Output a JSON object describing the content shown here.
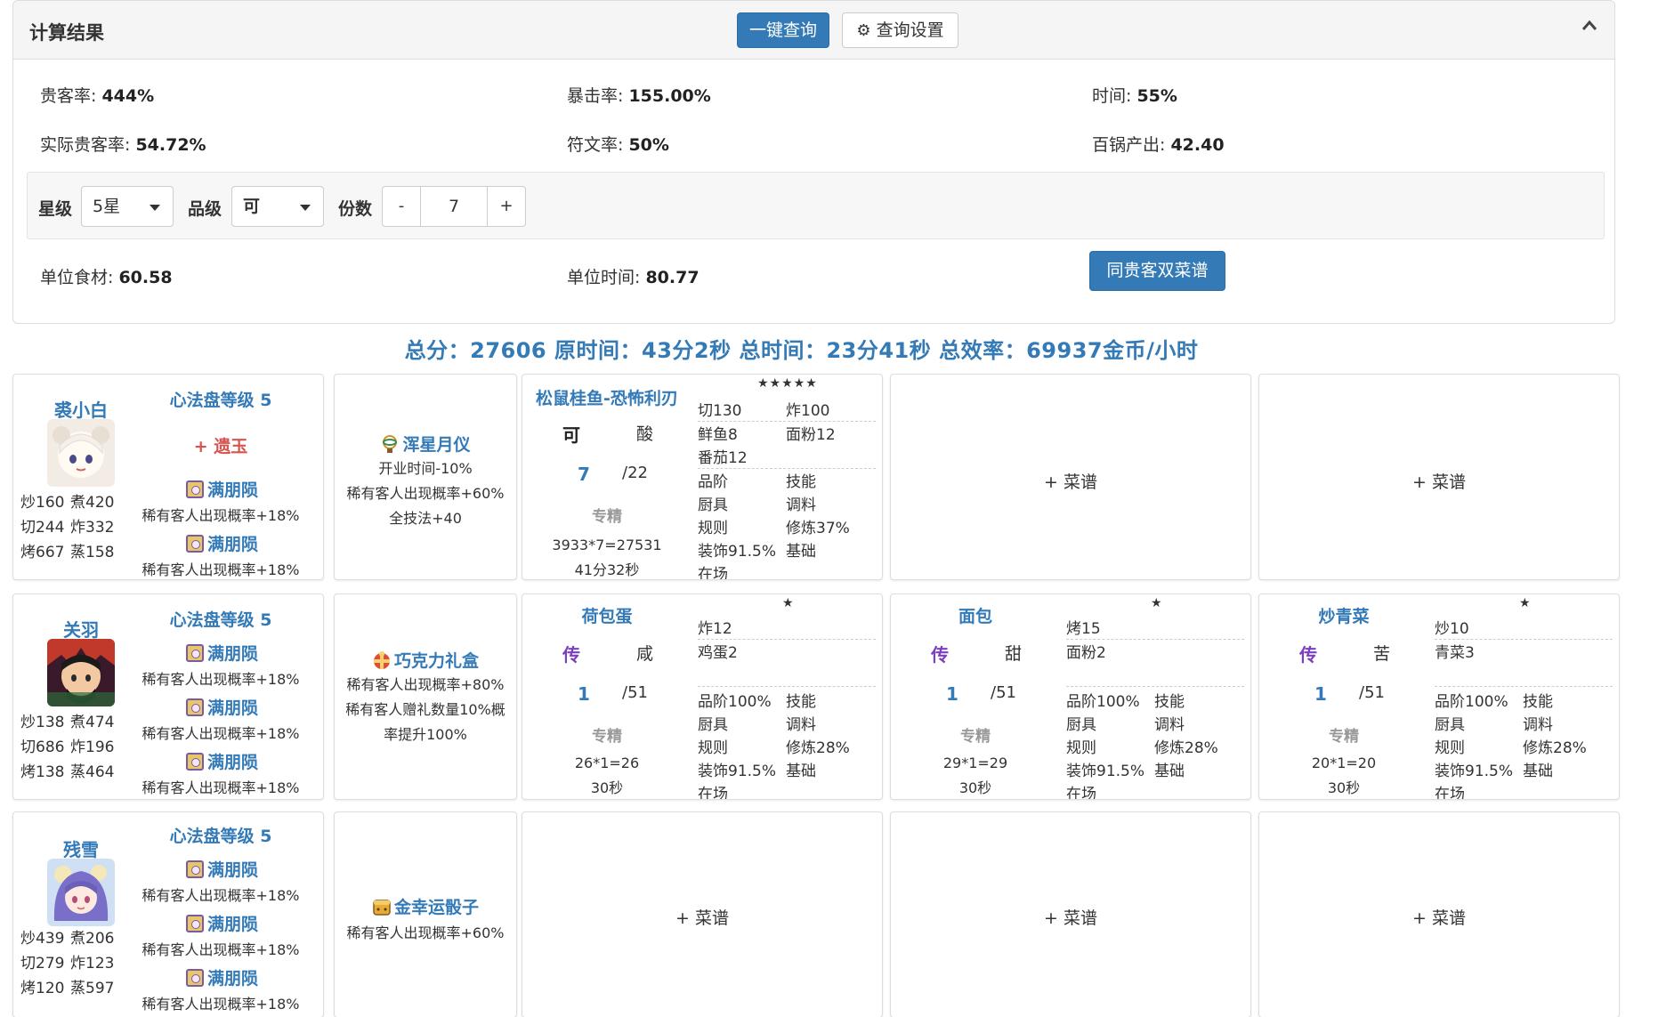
{
  "panel": {
    "title": "计算结果",
    "query_button": "一键查询",
    "settings_button": "查询设置",
    "stats": {
      "guest_rate_label": "贵客率:",
      "guest_rate": "444%",
      "crit_rate_label": "暴击率:",
      "crit_rate": "155.00%",
      "time_label": "时间:",
      "time": "55%",
      "actual_guest_rate_label": "实际贵客率:",
      "actual_guest_rate": "54.72%",
      "rune_rate_label": "符文率:",
      "rune_rate": "50%",
      "pot_output_label": "百锅产出:",
      "pot_output": "42.40",
      "unit_food_label": "单位食材:",
      "unit_food": "60.58",
      "unit_time_label": "单位时间:",
      "unit_time": "80.77"
    },
    "filters": {
      "star_label": "星级",
      "star_value": "5星",
      "grade_label": "品级",
      "grade_value": "可",
      "qty_label": "份数",
      "minus": "-",
      "qty_value": "7",
      "plus": "+"
    },
    "same_vip_button": "同贵客双菜谱"
  },
  "summary": "总分：27606 原时间：43分2秒 总时间：23分41秒 总效率：69937金币/小时",
  "chefs": [
    {
      "name": "裘小白",
      "stats": [
        "炒160",
        "煮420",
        "切244",
        "炸332",
        "烤667",
        "蒸158"
      ],
      "xinfa": "心法盘等级 5",
      "equip_add": "+ 遗玉",
      "skills": [
        {
          "name": "满朋陨",
          "desc": "稀有客人出现概率+18%"
        },
        {
          "name": "满朋陨",
          "desc": "稀有客人出现概率+18%"
        }
      ],
      "equip": {
        "name": "浑星月仪",
        "icon": "armillary-icon",
        "desc": [
          "开业时间-10%",
          "稀有客人出现概率+60%",
          "全技法+40"
        ]
      }
    },
    {
      "name": "关羽",
      "stats": [
        "炒138",
        "煮474",
        "切686",
        "炸196",
        "烤138",
        "蒸464"
      ],
      "xinfa": "心法盘等级 5",
      "skills": [
        {
          "name": "满朋陨",
          "desc": "稀有客人出现概率+18%"
        },
        {
          "name": "满朋陨",
          "desc": "稀有客人出现概率+18%"
        },
        {
          "name": "满朋陨",
          "desc": "稀有客人出现概率+18%"
        }
      ],
      "equip": {
        "name": "巧克力礼盒",
        "icon": "gift-box-icon",
        "desc": [
          "稀有客人出现概率+80%",
          "稀有客人赠礼数量10%概",
          "率提升100%"
        ]
      }
    },
    {
      "name": "残雪",
      "stats": [
        "炒439",
        "煮206",
        "切279",
        "炸123",
        "烤120",
        "蒸597"
      ],
      "xinfa": "心法盘等级 5",
      "skills": [
        {
          "name": "满朋陨",
          "desc": "稀有客人出现概率+18%"
        },
        {
          "name": "满朋陨",
          "desc": "稀有客人出现概率+18%"
        },
        {
          "name": "满朋陨",
          "desc": "稀有客人出现概率+18%"
        }
      ],
      "equip": {
        "name": "金幸运骰子",
        "icon": "dice-icon",
        "desc": [
          "稀有客人出现概率+60%"
        ]
      }
    }
  ],
  "recipes": {
    "r1": {
      "name": "松鼠桂鱼-恐怖利刃",
      "rarity": "★★★★★",
      "grade": "可",
      "taste": "酸",
      "qty": "7",
      "max": "/22",
      "spec": "专精",
      "calc": "3933*7=27531",
      "time": "41分32秒",
      "need": [
        "切130",
        "炸100"
      ],
      "ingredients": [
        "鲜鱼8",
        "面粉12",
        "番茄12"
      ],
      "reqs": [
        "品阶",
        "技能",
        "厨具",
        "调料",
        "规则",
        "修炼37%",
        "装饰91.5%",
        "基础",
        "在场"
      ]
    },
    "r2": {
      "name": "荷包蛋",
      "rarity": "★",
      "grade": "传",
      "taste": "咸",
      "qty": "1",
      "max": "/51",
      "spec": "专精",
      "calc": "26*1=26",
      "time": "30秒",
      "need": [
        "炸12"
      ],
      "ingredients": [
        "鸡蛋2"
      ],
      "reqs": [
        "品阶100%",
        "技能",
        "厨具",
        "调料",
        "规则",
        "修炼28%",
        "装饰91.5%",
        "基础",
        "在场"
      ]
    },
    "r3": {
      "name": "面包",
      "rarity": "★",
      "grade": "传",
      "taste": "甜",
      "qty": "1",
      "max": "/51",
      "spec": "专精",
      "calc": "29*1=29",
      "time": "30秒",
      "need": [
        "烤15"
      ],
      "ingredients": [
        "面粉2"
      ],
      "reqs": [
        "品阶100%",
        "技能",
        "厨具",
        "调料",
        "规则",
        "修炼28%",
        "装饰91.5%",
        "基础",
        "在场"
      ]
    },
    "r4": {
      "name": "炒青菜",
      "rarity": "★",
      "grade": "传",
      "taste": "苦",
      "qty": "1",
      "max": "/51",
      "spec": "专精",
      "calc": "20*1=20",
      "time": "30秒",
      "need": [
        "炒10"
      ],
      "ingredients": [
        "青菜3"
      ],
      "reqs": [
        "品阶100%",
        "技能",
        "厨具",
        "调料",
        "规则",
        "修炼28%",
        "装饰91.5%",
        "基础",
        "在场"
      ]
    },
    "add_label": "+ 菜谱"
  },
  "colors": {
    "primary": "#337ab7",
    "grade_ke": "#222222",
    "grade_chuan": "#7b3fbf",
    "equip_add": "#d9534f"
  }
}
